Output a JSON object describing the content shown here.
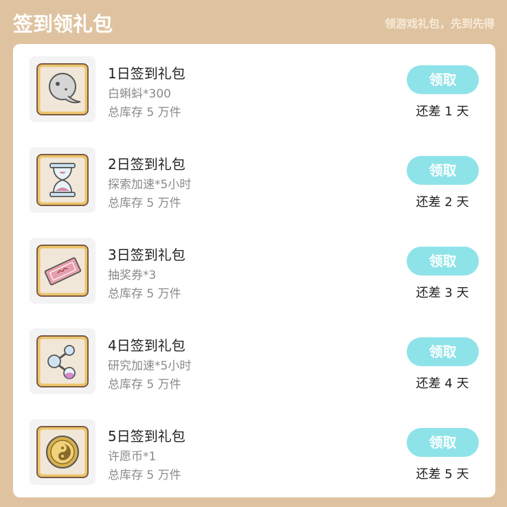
{
  "header": {
    "title": "签到领礼包",
    "subtitle": "领游戏礼包，先到先得"
  },
  "colors": {
    "background": "#dfc3a0",
    "button": "#8ee3e8",
    "frame": "#ecc46a"
  },
  "items": [
    {
      "name": "1日签到礼包",
      "reward": "白蝌蚪*300",
      "stock": "总库存 5 万件",
      "button": "领取",
      "remain": "还差 1 天",
      "icon": "tadpole-icon"
    },
    {
      "name": "2日签到礼包",
      "reward": "探索加速*5小时",
      "stock": "总库存 5 万件",
      "button": "领取",
      "remain": "还差 2 天",
      "icon": "hourglass-icon"
    },
    {
      "name": "3日签到礼包",
      "reward": "抽奖券*3",
      "stock": "总库存 5 万件",
      "button": "领取",
      "remain": "还差 3 天",
      "icon": "ticket-icon"
    },
    {
      "name": "4日签到礼包",
      "reward": "研究加速*5小时",
      "stock": "总库存 5 万件",
      "button": "领取",
      "remain": "还差 4 天",
      "icon": "flask-icon"
    },
    {
      "name": "5日签到礼包",
      "reward": "许愿币*1",
      "stock": "总库存 5 万件",
      "button": "领取",
      "remain": "还差 5 天",
      "icon": "coin-icon"
    }
  ]
}
